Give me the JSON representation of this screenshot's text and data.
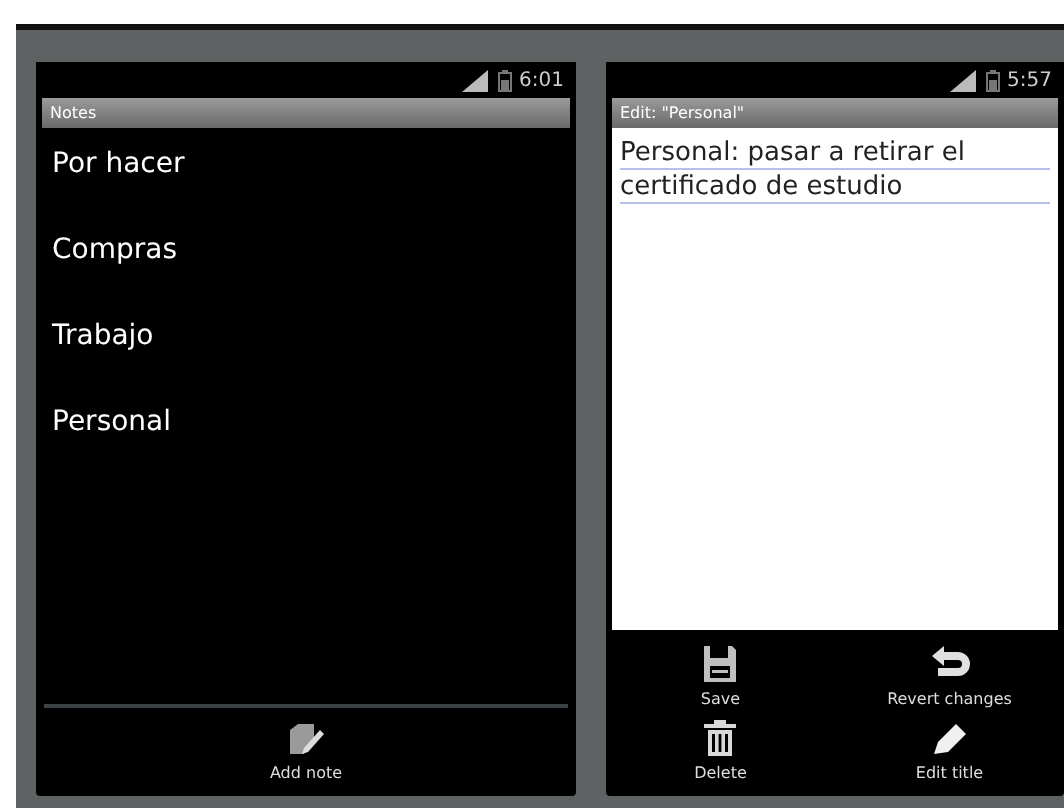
{
  "left_screen": {
    "status_bar": {
      "time": "6:01"
    },
    "title": "Notes",
    "notes": [
      {
        "title": "Por hacer"
      },
      {
        "title": "Compras"
      },
      {
        "title": "Trabajo"
      },
      {
        "title": "Personal"
      }
    ],
    "menu": [
      {
        "label": "Add note",
        "kind": "add"
      }
    ]
  },
  "right_screen": {
    "status_bar": {
      "time": "5:57"
    },
    "title": "Edit: \"Personal\"",
    "note_text": "Personal: pasar a retirar el certificado de estudio",
    "menu": [
      {
        "label": "Save",
        "kind": "save"
      },
      {
        "label": "Revert changes",
        "kind": "revert"
      },
      {
        "label": "Delete",
        "kind": "delete"
      },
      {
        "label": "Edit title",
        "kind": "edit"
      }
    ]
  }
}
